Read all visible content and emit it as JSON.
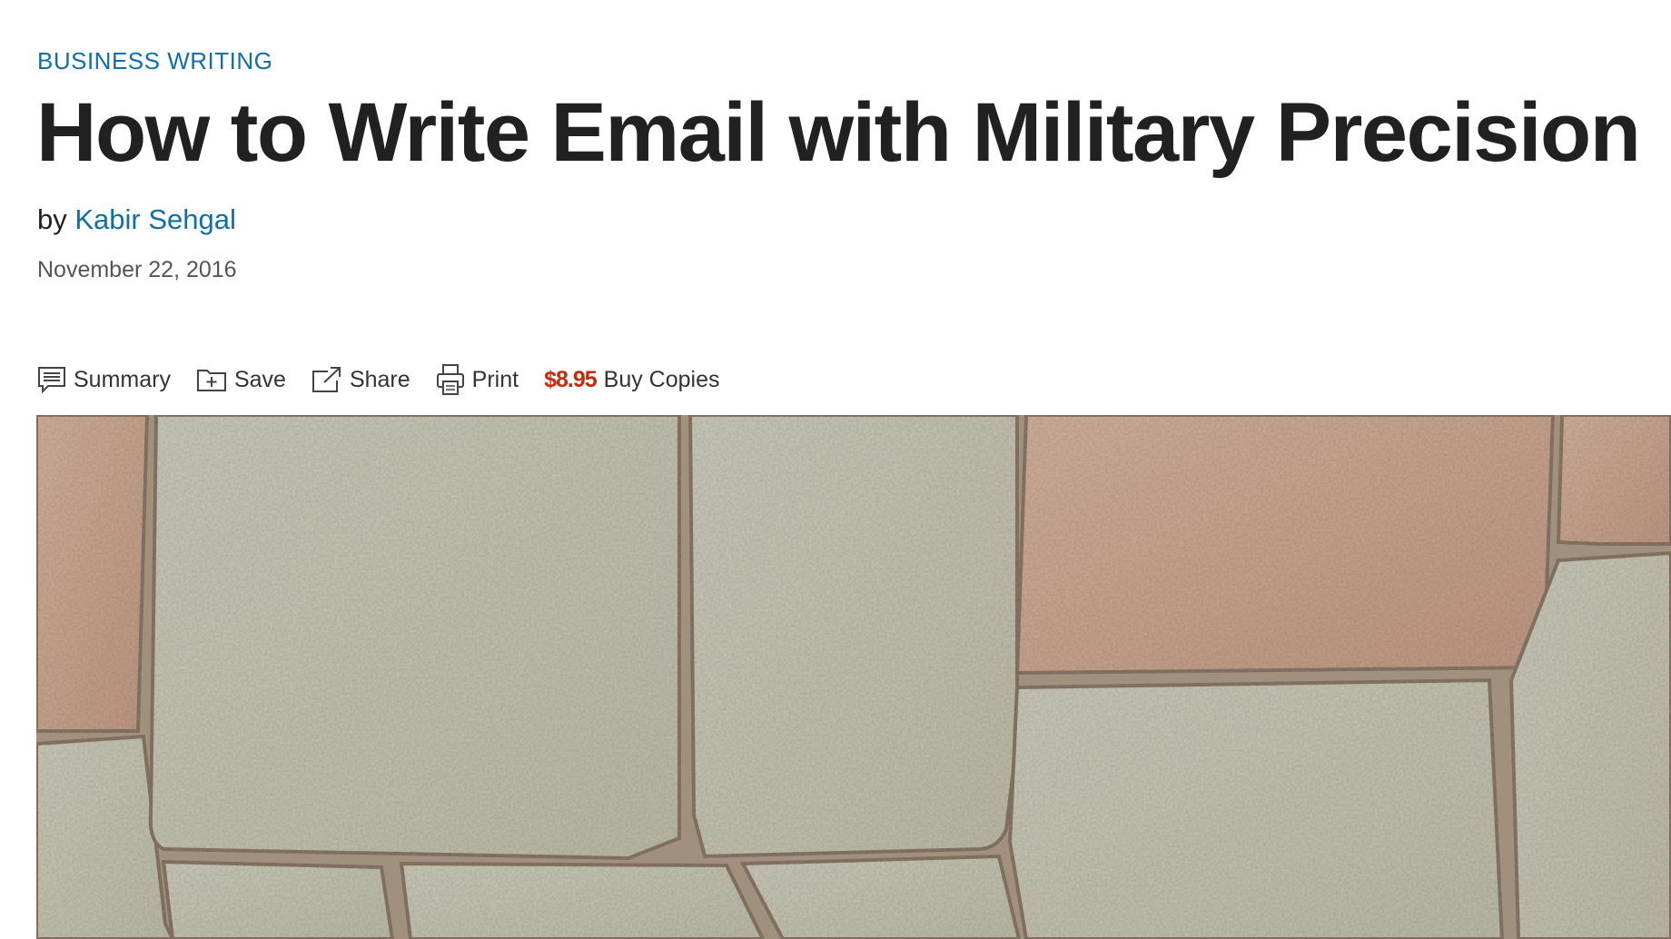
{
  "article": {
    "kicker": "BUSINESS WRITING",
    "title": "How to Write Email with Military Precision",
    "byline_prefix": "by",
    "author": "Kabir Sehgal",
    "date": "November 22, 2016"
  },
  "toolbar": {
    "summary_label": "Summary",
    "save_label": "Save",
    "share_label": "Share",
    "print_label": "Print",
    "price": "$8.95",
    "buy_label": "Buy Copies"
  },
  "colors": {
    "accent": "#0f6fa8",
    "price": "#c42a0b",
    "title": "#212121"
  },
  "hero_image": {
    "subject": "photograph of close-fitting stone wall blocks"
  }
}
